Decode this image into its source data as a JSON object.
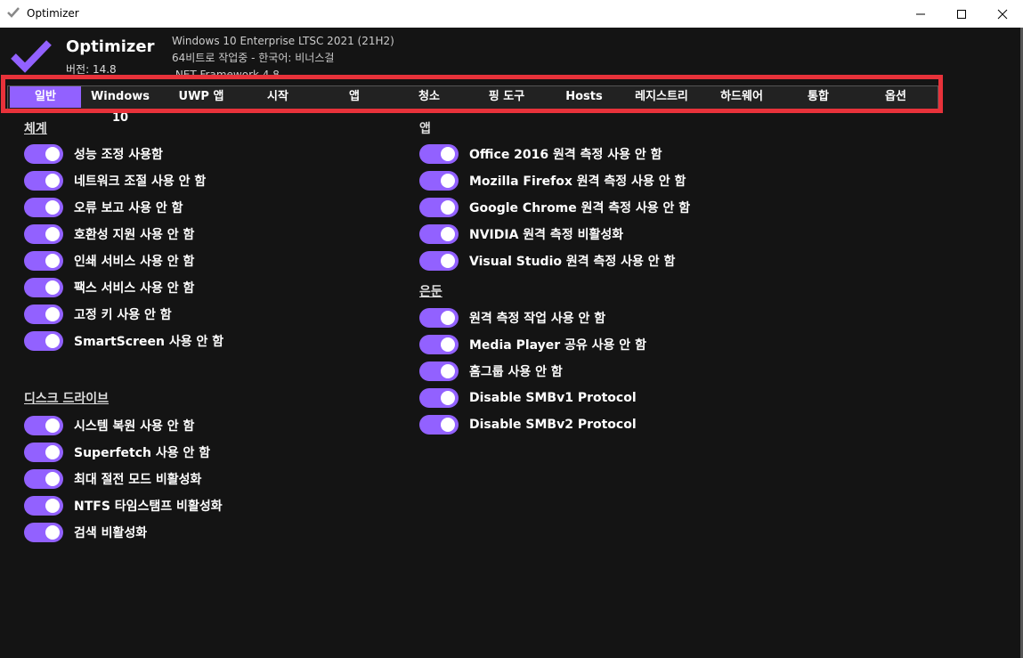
{
  "window": {
    "title": "Optimizer",
    "minimize_icon": "minimize-icon",
    "maximize_icon": "maximize-icon",
    "close_icon": "close-icon"
  },
  "header": {
    "app_name": "Optimizer",
    "version": "버전: 14.8",
    "sys_line1": "Windows 10 Enterprise LTSC 2021 (21H2)",
    "sys_line2": "64비트로 작업중 - 한국어: 비너스걸",
    "sys_line3": ".NET Framework 4.8",
    "accent": "#9261ff"
  },
  "tabs": [
    "일반",
    "Windows 10",
    "UWP 앱",
    "시작",
    "앱",
    "청소",
    "핑 도구",
    "Hosts",
    "레지스트리",
    "하드웨어",
    "통합",
    "옵션"
  ],
  "sections": {
    "system": {
      "title": "체계",
      "items": [
        "성능 조정 사용함",
        "네트워크 조절 사용 안 함",
        "오류 보고 사용 안 함",
        "호환성 지원 사용 안 함",
        "인쇄 서비스 사용 안 함",
        "팩스 서비스 사용 안 함",
        "고정 키 사용 안 함",
        "SmartScreen 사용 안 함"
      ]
    },
    "disk": {
      "title": "디스크 드라이브",
      "items": [
        "시스템 복원 사용 안 함",
        "Superfetch 사용 안 함",
        "최대 절전 모드 비활성화",
        "NTFS 타임스탬프 비활성화",
        "검색 비활성화"
      ]
    },
    "apps": {
      "title": "앱",
      "items": [
        "Office 2016 원격 측정 사용 안 함",
        "Mozilla Firefox 원격 측정 사용 안 함",
        "Google Chrome 원격 측정 사용 안 함",
        "NVIDIA 원격 측정 비활성화",
        "Visual Studio 원격 측정 사용 안 함"
      ]
    },
    "misc": {
      "title": "은둔",
      "items": [
        "원격 측정 작업 사용 안 함",
        "Media Player 공유 사용 안 함",
        "홈그룹 사용 안 함",
        "Disable SMBv1 Protocol",
        "Disable SMBv2 Protocol"
      ]
    }
  }
}
